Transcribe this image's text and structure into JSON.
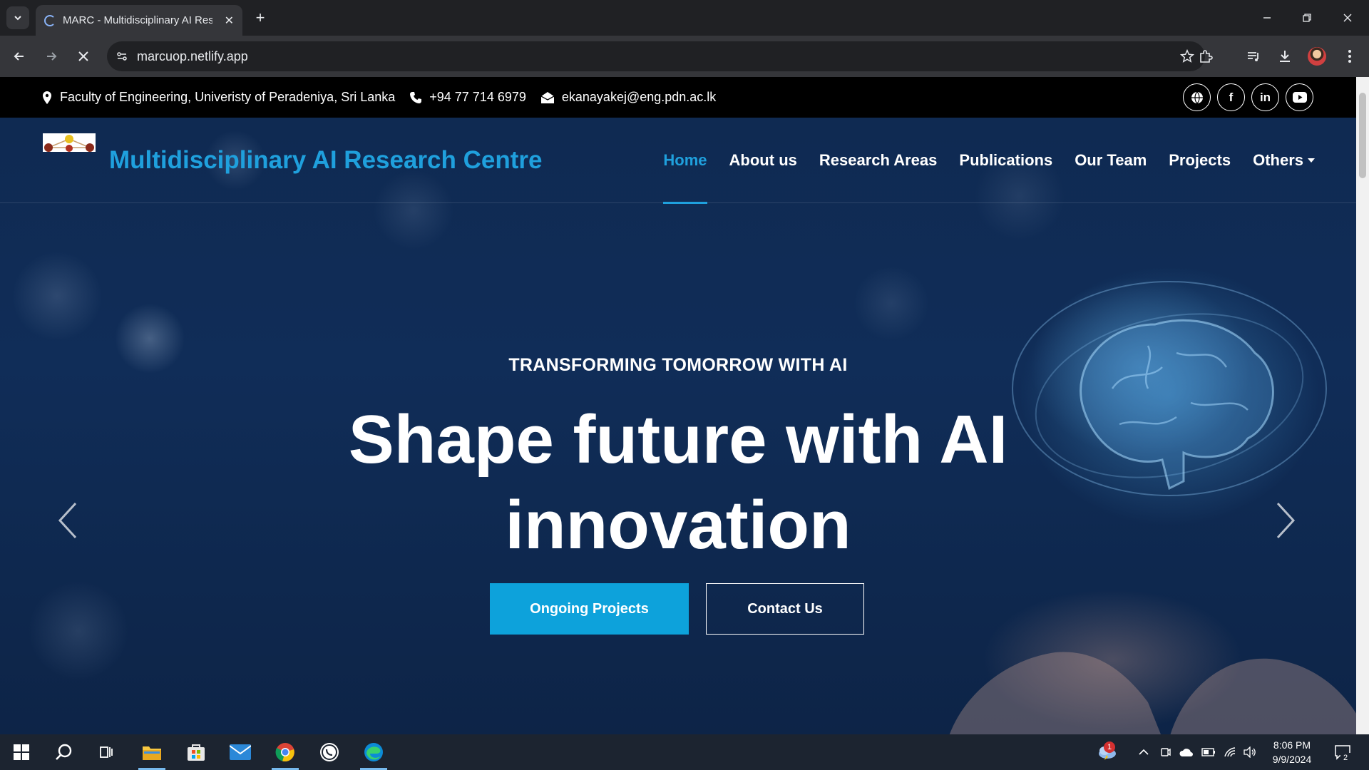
{
  "browser": {
    "tab_title": "MARC - Multidisciplinary AI Research Centre",
    "url": "marcuop.netlify.app"
  },
  "topbar": {
    "address": "Faculty of Engineering, Univeristy of Peradeniya, Sri Lanka",
    "phone": "+94 77 714 6979",
    "email": "ekanayakej@eng.pdn.ac.lk",
    "socials": [
      "globe-icon",
      "facebook-icon",
      "linkedin-icon",
      "youtube-icon"
    ]
  },
  "navbar": {
    "brand": "Multidisciplinary AI Research Centre",
    "items": [
      {
        "label": "Home",
        "active": true
      },
      {
        "label": "About us"
      },
      {
        "label": "Research Areas"
      },
      {
        "label": "Publications"
      },
      {
        "label": "Our Team"
      },
      {
        "label": "Projects"
      },
      {
        "label": "Others",
        "dropdown": true
      }
    ]
  },
  "hero": {
    "subtitle": "TRANSFORMING TOMORROW WITH AI",
    "headline_line1": "Shape future with AI",
    "headline_line2": "innovation",
    "primary_button": "Ongoing Projects",
    "secondary_button": "Contact Us"
  },
  "taskbar": {
    "time": "8:06 PM",
    "date": "9/9/2024",
    "weather_badge": "1",
    "notification_count": "2"
  },
  "colors": {
    "accent": "#1fa0dd",
    "button": "#0da2db",
    "topbar_bg": "#000000"
  }
}
